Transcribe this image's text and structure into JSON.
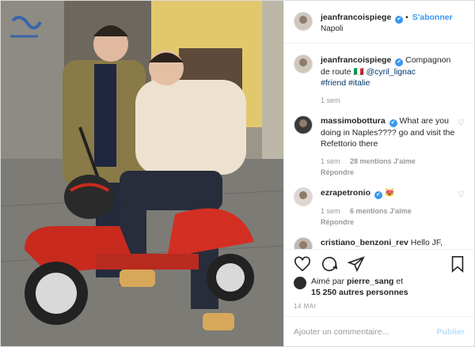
{
  "header": {
    "username": "jeanfrancoispiege",
    "verified_mark": "✔",
    "separator": "•",
    "follow_label": "S'abonner",
    "location": "Napoli"
  },
  "caption": {
    "username": "jeanfrancoispiege",
    "text": "Compagnon de route 🇮🇹",
    "mention": "@cyril_lignac",
    "hashtags": "#friend #italie",
    "time": "1 sem"
  },
  "comments": [
    {
      "username": "massimobottura",
      "text": "What are you doing in Naples???? go and visit the Refettorio there",
      "time": "1 sem",
      "likes": "28 mentions J'aime",
      "reply": "Répondre"
    },
    {
      "username": "ezrapetronio",
      "text": "😻",
      "time": "1 sem",
      "likes": "6 mentions J'aime",
      "reply": "Répondre"
    },
    {
      "username": "cristiano_benzoni_rev",
      "text": "Hello JF, parfaitement tropicalisés. Bises"
    }
  ],
  "likes": {
    "prefix": "Aimé par",
    "by": "pierre_sang",
    "conj": "et",
    "others": "15 250 autres personnes"
  },
  "date": "14 MAI",
  "add_comment": {
    "placeholder": "Ajouter un commentaire...",
    "post_label": "Publier"
  },
  "icons": [
    "heart-icon",
    "comment-icon",
    "share-icon",
    "bookmark-icon"
  ]
}
